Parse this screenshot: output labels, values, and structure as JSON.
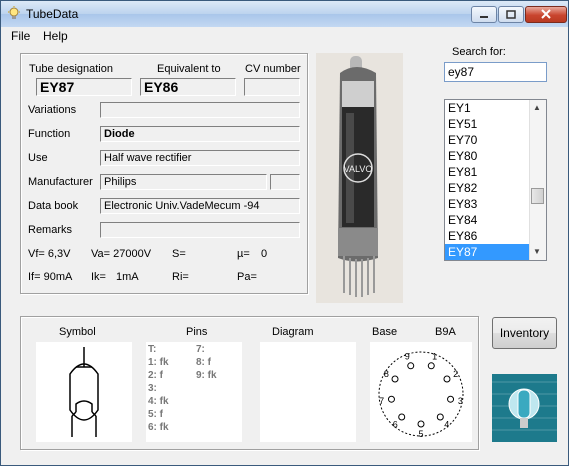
{
  "window": {
    "title": "TubeData"
  },
  "menu": {
    "file": "File",
    "help": "Help"
  },
  "fields": {
    "designation_label": "Tube designation",
    "designation": "EY87",
    "equivalent_label": "Equivalent to",
    "equivalent": "EY86",
    "cv_label": "CV number",
    "cv": "",
    "variations_label": "Variations",
    "variations": "",
    "function_label": "Function",
    "function": "Diode",
    "use_label": "Use",
    "use": "Half wave rectifier",
    "manufacturer_label": "Manufacturer",
    "manufacturer": "Philips",
    "manufacturer_extra": "",
    "databook_label": "Data book",
    "databook": "Electronic Univ.VadeMecum -94",
    "remarks_label": "Remarks",
    "remarks": ""
  },
  "specs": {
    "vf": "Vf= 6,3V",
    "va": "Va= 27000V",
    "s": "S=",
    "mu": "µ=",
    "mu_val": "0",
    "if": "If= 90mA",
    "ik": "Ik=",
    "ik_val": "1mA",
    "ri": "Ri=",
    "pa": "Pa="
  },
  "search": {
    "label": "Search for:",
    "value": "ey87"
  },
  "tube_list": {
    "items": [
      "EY1",
      "EY51",
      "EY70",
      "EY80",
      "EY81",
      "EY82",
      "EY83",
      "EY84",
      "EY86",
      "EY87"
    ],
    "selected": "EY87"
  },
  "bottom": {
    "symbol_label": "Symbol",
    "pins_label": "Pins",
    "diagram_label": "Diagram",
    "base_label": "Base",
    "base_type": "B9A",
    "pins_col1": [
      "T:",
      "1: fk",
      "2: f",
      "3:",
      "4: fk",
      "5: f",
      "6: fk"
    ],
    "pins_col2": [
      "7:",
      "8: f",
      "9: fk"
    ],
    "base_numbers": [
      "1",
      "2",
      "3",
      "4",
      "5",
      "6",
      "7",
      "8",
      "9"
    ]
  },
  "buttons": {
    "inventory": "Inventory"
  },
  "tube_photo_text": "VALVO"
}
